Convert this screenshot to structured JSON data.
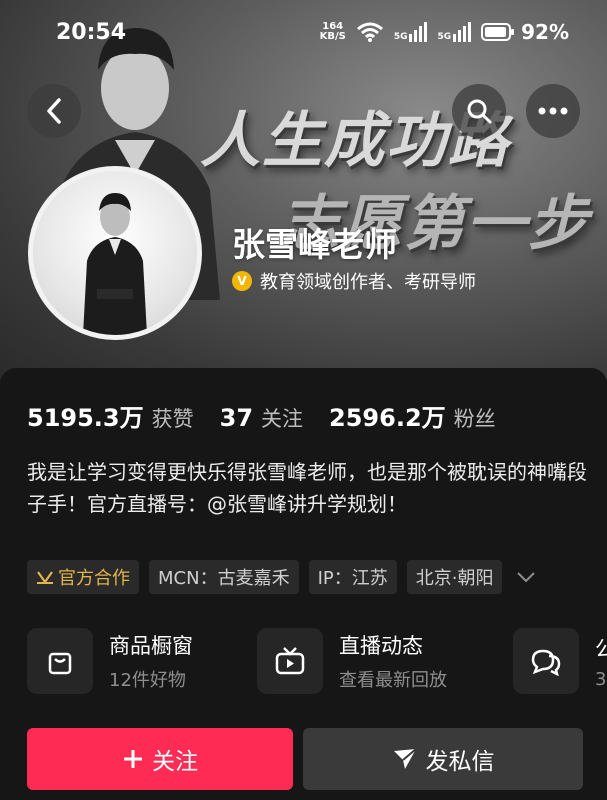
{
  "status_bar": {
    "time": "20:54",
    "net_speed_value": "164",
    "net_speed_unit": "KB/S",
    "signal_1": "5G",
    "signal_2": "5G",
    "battery": "92%"
  },
  "banner": {
    "slogan_line1": "人生成功路",
    "slogan_line2": "志愿第一步"
  },
  "nav": {
    "back_icon": "chevron-left-icon",
    "search_icon": "search-icon",
    "more_icon": "more-dots-icon"
  },
  "profile": {
    "name": "张雪峰老师",
    "verification": "教育领域创作者、考研导师",
    "verify_color": "#f2b705"
  },
  "stats": [
    {
      "value": "5195.3万",
      "label": "获赞"
    },
    {
      "value": "37",
      "label": "关注"
    },
    {
      "value": "2596.2万",
      "label": "粉丝"
    }
  ],
  "bio": "我是让学习变得更快乐得张雪峰老师，也是那个被耽误的神嘴段子手！官方直播号：@张雪峰讲升学规划！",
  "tags": {
    "official": "官方合作",
    "mcn": "MCN：古麦嘉禾",
    "ip": "IP：江苏",
    "location": "北京·朝阳"
  },
  "features": [
    {
      "title": "商品橱窗",
      "subtitle": "12件好物",
      "icon": "shopping-bag-icon"
    },
    {
      "title": "直播动态",
      "subtitle": "查看最新回放",
      "icon": "tv-icon"
    },
    {
      "title": "公",
      "subtitle": "3",
      "icon": "chat-bubbles-icon"
    }
  ],
  "actions": {
    "follow": "关注",
    "message": "发私信",
    "follow_color": "#fe2c55"
  }
}
